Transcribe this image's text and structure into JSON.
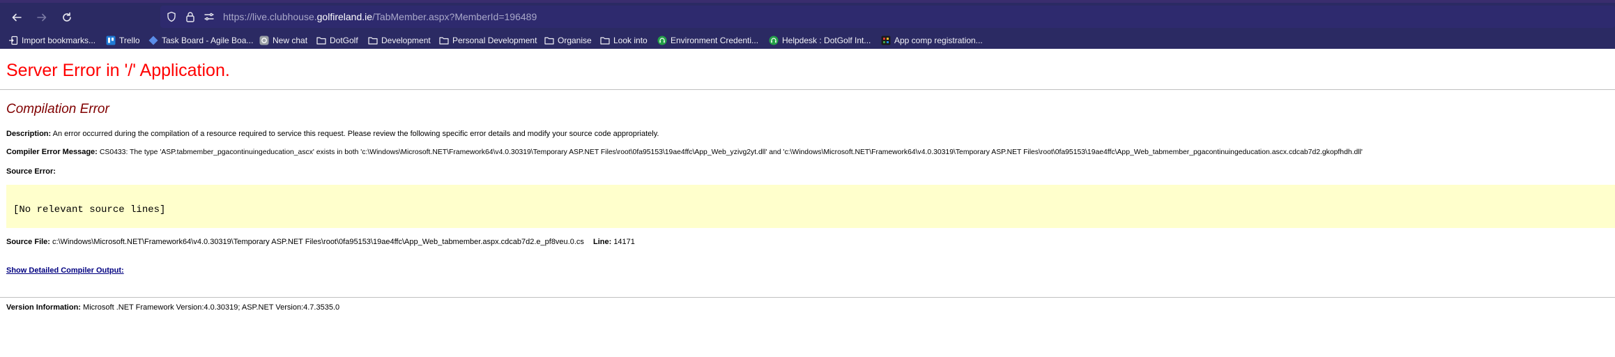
{
  "browser": {
    "url_prefix": "https://live.clubhouse.",
    "url_host": "golfireland.ie",
    "url_path": "/TabMember.aspx?MemberId=196489"
  },
  "bookmarks": [
    {
      "label": "Import bookmarks...",
      "icon": "import-icon"
    },
    {
      "label": "Trello",
      "icon": "trello-icon"
    },
    {
      "label": "Task Board - Agile Boa...",
      "icon": "diamond-icon"
    },
    {
      "label": "New chat",
      "icon": "chat-icon"
    },
    {
      "label": "DotGolf",
      "icon": "folder-icon"
    },
    {
      "label": "Development",
      "icon": "folder-icon"
    },
    {
      "label": "Personal Development",
      "icon": "folder-icon"
    },
    {
      "label": "Organise",
      "icon": "folder-icon"
    },
    {
      "label": "Look into",
      "icon": "folder-icon"
    },
    {
      "label": "Environment Credenti...",
      "icon": "headset-icon"
    },
    {
      "label": "Helpdesk : DotGolf Int...",
      "icon": "headset-icon"
    },
    {
      "label": "App comp registration...",
      "icon": "app-icon"
    }
  ],
  "page": {
    "title": "Server Error in '/' Application.",
    "subtitle": "Compilation Error",
    "description_label": "Description:",
    "description": "An error occurred during the compilation of a resource required to service this request. Please review the following specific error details and modify your source code appropriately.",
    "compiler_label": "Compiler Error Message:",
    "compiler_message": "CS0433: The type 'ASP.tabmember_pgacontinuingeducation_ascx' exists in both 'c:\\Windows\\Microsoft.NET\\Framework64\\v4.0.30319\\Temporary ASP.NET Files\\root\\0fa95153\\19ae4ffc\\App_Web_yzivg2yt.dll' and 'c:\\Windows\\Microsoft.NET\\Framework64\\v4.0.30319\\Temporary ASP.NET Files\\root\\0fa95153\\19ae4ffc\\App_Web_tabmember_pgacontinuingeducation.ascx.cdcab7d2.gkopfhdh.dll'",
    "source_error_label": "Source Error:",
    "source_lines": "[No relevant source lines]",
    "source_file_label": "Source File:",
    "source_file": "c:\\Windows\\Microsoft.NET\\Framework64\\v4.0.30319\\Temporary ASP.NET Files\\root\\0fa95153\\19ae4ffc\\App_Web_tabmember.aspx.cdcab7d2.e_pf8veu.0.cs",
    "line_label": "Line:",
    "line_value": "14171",
    "show_output_link": "Show Detailed Compiler Output:",
    "version_label": "Version Information:",
    "version_value": "Microsoft .NET Framework Version:4.0.30319; ASP.NET Version:4.7.3535.0"
  }
}
